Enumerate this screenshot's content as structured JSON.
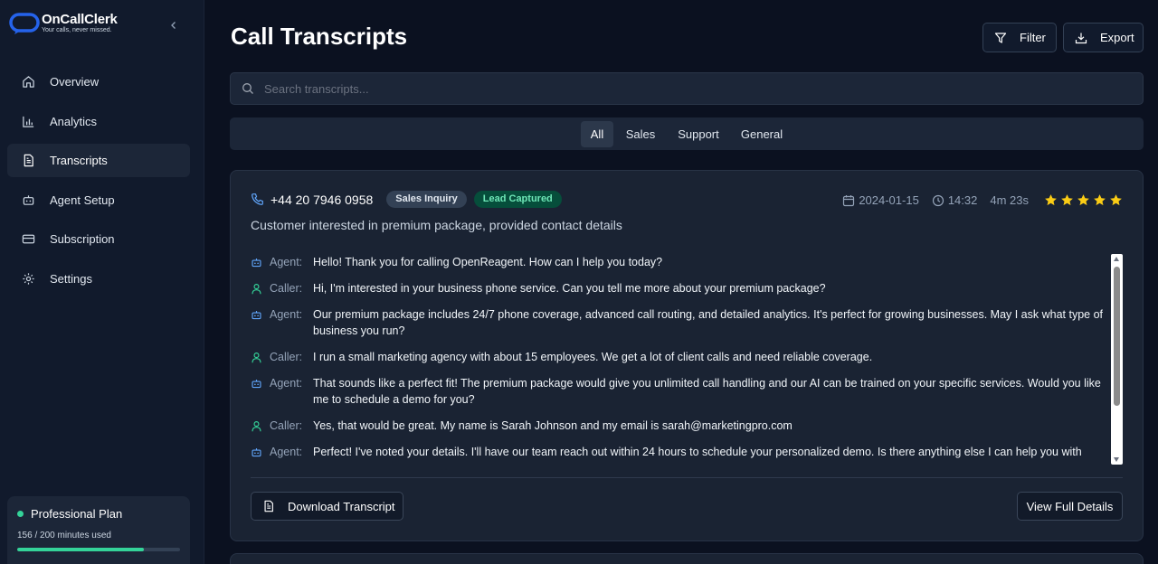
{
  "brand": {
    "name": "OnCallClerk",
    "tagline": "Your calls, never missed.",
    "accent": "#2563eb"
  },
  "sidebar": {
    "items": [
      {
        "label": "Overview",
        "icon": "home-icon"
      },
      {
        "label": "Analytics",
        "icon": "bar-chart-icon"
      },
      {
        "label": "Transcripts",
        "icon": "document-icon"
      },
      {
        "label": "Agent Setup",
        "icon": "bot-icon"
      },
      {
        "label": "Subscription",
        "icon": "credit-card-icon"
      },
      {
        "label": "Settings",
        "icon": "gear-icon"
      }
    ],
    "active": "Transcripts",
    "plan": {
      "name": "Professional Plan",
      "usage_text": "156 / 200 minutes used",
      "used": 156,
      "total": 200
    }
  },
  "header": {
    "title": "Call Transcripts",
    "filter_label": "Filter",
    "export_label": "Export"
  },
  "search": {
    "placeholder": "Search transcripts..."
  },
  "tabs": [
    {
      "label": "All",
      "active": true
    },
    {
      "label": "Sales",
      "active": false
    },
    {
      "label": "Support",
      "active": false
    },
    {
      "label": "General",
      "active": false
    }
  ],
  "call": {
    "phone": "+44 20 7946 0958",
    "category": "Sales Inquiry",
    "status": "Lead Captured",
    "date": "2024-01-15",
    "time": "14:32",
    "duration": "4m 23s",
    "rating": 5,
    "summary": "Customer interested in premium package, provided contact details",
    "messages": [
      {
        "speaker": "Agent:",
        "text": "Hello! Thank you for calling OpenReagent. How can I help you today?"
      },
      {
        "speaker": "Caller:",
        "text": "Hi, I'm interested in your business phone service. Can you tell me more about your premium package?"
      },
      {
        "speaker": "Agent:",
        "text": "Our premium package includes 24/7 phone coverage, advanced call routing, and detailed analytics. It's perfect for growing businesses. May I ask what type of business you run?"
      },
      {
        "speaker": "Caller:",
        "text": "I run a small marketing agency with about 15 employees. We get a lot of client calls and need reliable coverage."
      },
      {
        "speaker": "Agent:",
        "text": "That sounds like a perfect fit! The premium package would give you unlimited call handling and our AI can be trained on your specific services. Would you like me to schedule a demo for you?"
      },
      {
        "speaker": "Caller:",
        "text": "Yes, that would be great. My name is Sarah Johnson and my email is sarah@marketingpro.com"
      },
      {
        "speaker": "Agent:",
        "text": "Perfect! I've noted your details. I'll have our team reach out within 24 hours to schedule your personalized demo. Is there anything else I can help you with"
      }
    ],
    "download_label": "Download Transcript",
    "details_label": "View Full Details"
  },
  "colors": {
    "background": "#0b1120",
    "card": "#1a2333",
    "success": "#34d399",
    "star": "#facc15"
  }
}
